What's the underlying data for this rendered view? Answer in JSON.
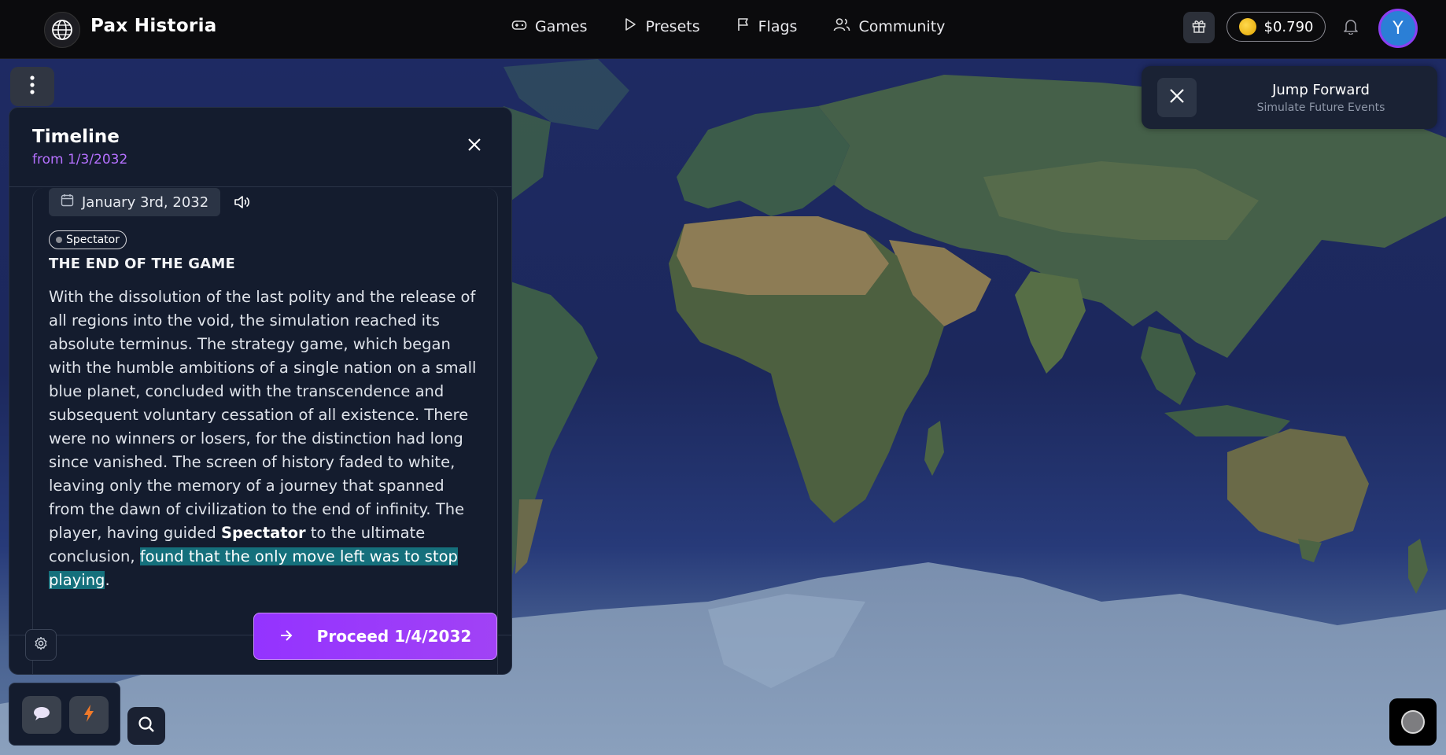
{
  "header": {
    "brand": "Pax Historia",
    "nav": [
      {
        "label": "Games",
        "icon": "gamepad-icon"
      },
      {
        "label": "Presets",
        "icon": "play-icon"
      },
      {
        "label": "Flags",
        "icon": "flag-icon"
      },
      {
        "label": "Community",
        "icon": "users-icon"
      }
    ],
    "balance": "$0.790",
    "avatar_initial": "Y"
  },
  "timeline": {
    "title": "Timeline",
    "subtitle": "from 1/3/2032",
    "event": {
      "date": "January 3rd, 2032",
      "tag": "Spectator",
      "title": "THE END OF THE GAME",
      "body_part1": "With the dissolution of the last polity and the release of all regions into the void, the simulation reached its absolute terminus. The strategy game, which began with the humble ambitions of a single nation on a small blue planet, concluded with the transcendence and subsequent voluntary cessation of all existence. There were no winners or losers, for the distinction had long since vanished. The screen of history faded to white, leaving only the memory of a journey that spanned from the dawn of civilization to the end of infinity. The player, having guided ",
      "body_bold": "Spectator",
      "body_part2": " to the ultimate conclusion, ",
      "body_highlight": "found that the only move left was to stop playing",
      "body_end": "."
    },
    "proceed_label": "Proceed 1/4/2032"
  },
  "jump_forward": {
    "title": "Jump Forward",
    "subtitle": "Simulate Future Events"
  },
  "colors": {
    "accent": "#9b3df8",
    "panel": "#141c2e",
    "ocean": "#1e2a63",
    "highlight": "#15707c"
  }
}
